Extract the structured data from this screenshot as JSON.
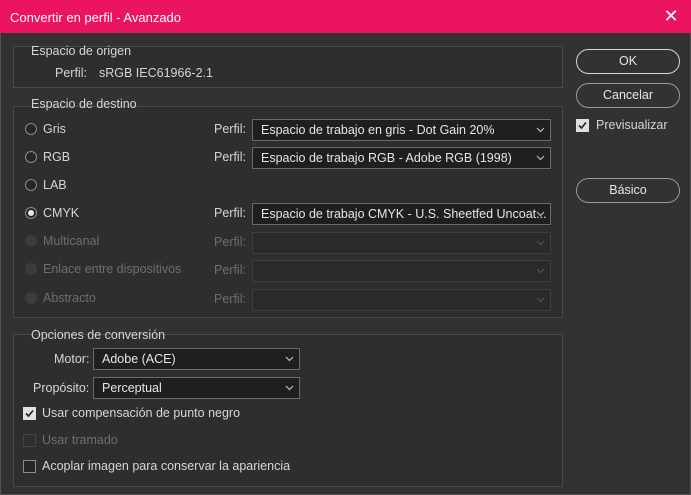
{
  "window": {
    "title": "Convertir en perfil - Avanzado",
    "close_glyph": "✕"
  },
  "source": {
    "legend": "Espacio de origen",
    "profile_label": "Perfil:",
    "profile_value": "sRGB IEC61966-2.1"
  },
  "destination": {
    "legend": "Espacio de destino",
    "profile_label": "Perfil:",
    "options": [
      {
        "label": "Gris",
        "selected": false,
        "enabled": true,
        "profile": "Espacio de trabajo en gris - Dot Gain 20%"
      },
      {
        "label": "RGB",
        "selected": false,
        "enabled": true,
        "profile": "Espacio de trabajo RGB - Adobe RGB (1998)"
      },
      {
        "label": "LAB",
        "selected": false,
        "enabled": true,
        "profile": ""
      },
      {
        "label": "CMYK",
        "selected": true,
        "enabled": true,
        "profile": "Espacio de trabajo CMYK - U.S. Sheetfed Uncoat..."
      },
      {
        "label": "Multicanal",
        "selected": false,
        "enabled": false,
        "profile": ""
      },
      {
        "label": "Enlace entre dispositivos",
        "selected": false,
        "enabled": false,
        "profile": ""
      },
      {
        "label": "Abstracto",
        "selected": false,
        "enabled": false,
        "profile": ""
      }
    ]
  },
  "conversion": {
    "legend": "Opciones de conversión",
    "engine_label": "Motor:",
    "engine_value": "Adobe (ACE)",
    "intent_label": "Propósito:",
    "intent_value": "Perceptual",
    "black_point": {
      "label": "Usar compensación de punto negro",
      "checked": true,
      "enabled": true
    },
    "dither": {
      "label": "Usar tramado",
      "checked": false,
      "enabled": false
    },
    "flatten": {
      "label": "Acoplar imagen para conservar la apariencia",
      "checked": false,
      "enabled": true
    }
  },
  "buttons": {
    "ok": "OK",
    "cancel": "Cancelar",
    "basic": "Básico"
  },
  "preview": {
    "label": "Previsualizar",
    "checked": true
  },
  "icons": {
    "caret": "chevron-down-icon",
    "check": "checkmark-icon"
  }
}
